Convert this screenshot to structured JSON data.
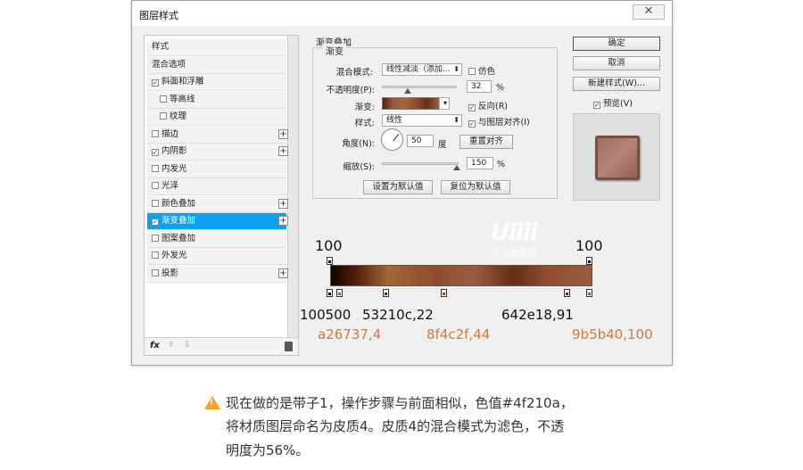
{
  "dialog": {
    "title": "图层样式",
    "close_label": "✕"
  },
  "style_list": {
    "items": [
      {
        "label": "样式",
        "checkbox": false,
        "checked": false,
        "plus": false,
        "indent": false,
        "selected": false
      },
      {
        "label": "混合选项",
        "checkbox": false,
        "checked": false,
        "plus": false,
        "indent": false,
        "selected": false
      },
      {
        "label": "斜面和浮雕",
        "checkbox": true,
        "checked": true,
        "plus": false,
        "indent": false,
        "selected": false
      },
      {
        "label": "等高线",
        "checkbox": true,
        "checked": false,
        "plus": false,
        "indent": true,
        "selected": false
      },
      {
        "label": "纹理",
        "checkbox": true,
        "checked": false,
        "plus": false,
        "indent": true,
        "selected": false
      },
      {
        "label": "描边",
        "checkbox": true,
        "checked": false,
        "plus": true,
        "indent": false,
        "selected": false
      },
      {
        "label": "内阴影",
        "checkbox": true,
        "checked": true,
        "plus": true,
        "indent": false,
        "selected": false
      },
      {
        "label": "内发光",
        "checkbox": true,
        "checked": false,
        "plus": false,
        "indent": false,
        "selected": false
      },
      {
        "label": "光泽",
        "checkbox": true,
        "checked": false,
        "plus": false,
        "indent": false,
        "selected": false
      },
      {
        "label": "颜色叠加",
        "checkbox": true,
        "checked": false,
        "plus": true,
        "indent": false,
        "selected": false
      },
      {
        "label": "渐变叠加",
        "checkbox": true,
        "checked": true,
        "plus": true,
        "indent": false,
        "selected": true
      },
      {
        "label": "图案叠加",
        "checkbox": true,
        "checked": false,
        "plus": false,
        "indent": false,
        "selected": false
      },
      {
        "label": "外发光",
        "checkbox": true,
        "checked": false,
        "plus": false,
        "indent": false,
        "selected": false
      },
      {
        "label": "投影",
        "checkbox": true,
        "checked": false,
        "plus": true,
        "indent": false,
        "selected": false
      }
    ],
    "fx_label": "fx",
    "up_arrow": "⇧",
    "down_arrow": "⇩"
  },
  "gradient_overlay": {
    "section_title": "渐变叠加",
    "group_title": "渐变",
    "blend_mode_label": "混合模式:",
    "blend_mode_value": "线性减淡（添加...",
    "dither_label": "仿色",
    "opacity_label": "不透明度(P):",
    "opacity_value": "32",
    "opacity_unit": "%",
    "gradient_label": "渐变:",
    "reverse_label": "反向(R)",
    "style_label": "样式:",
    "style_value": "线性",
    "align_label": "与图层对齐(I)",
    "angle_label": "角度(N):",
    "angle_value": "50",
    "angle_unit": "度",
    "reset_align_label": "重置对齐",
    "scale_label": "缩放(S):",
    "scale_value": "150",
    "scale_unit": "%",
    "set_default_label": "设置为默认值",
    "reset_default_label": "复位为默认值"
  },
  "right_panel": {
    "ok_label": "确定",
    "cancel_label": "取消",
    "new_style_label": "新建样式(W)...",
    "preview_label": "预览(V)"
  },
  "gradient_editor": {
    "left_opacity": "100",
    "right_opacity": "100",
    "stop_labels_top": [
      "100500",
      "53210c,22",
      "642e18,91"
    ],
    "stop_labels_bottom": [
      "a26737,4",
      "8f4c2f,44",
      "9b5b40,100"
    ],
    "watermark": "Uiiii",
    "watermark_sub": "优优教程网"
  },
  "note": {
    "lines": [
      "现在做的是带子1，操作步骤与前面相似，色值#4f210a，",
      "将材质图层命名为皮质4。皮质4的混合模式为滤色，不透",
      "明度为56%。"
    ]
  },
  "colors": {
    "accent": "#0aa1f0",
    "label_orange": "#d2793a",
    "warning": "#f4a32a"
  }
}
